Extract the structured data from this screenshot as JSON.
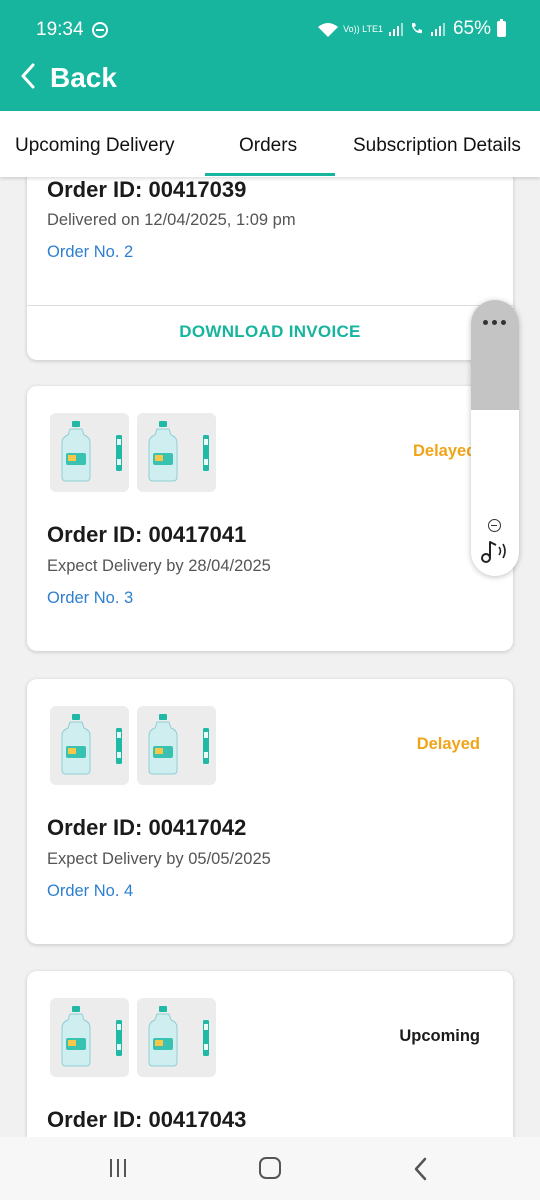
{
  "status_bar": {
    "time": "19:34",
    "lte_label": "Vo)) LTE1",
    "battery": "65%"
  },
  "header": {
    "back_label": "Back"
  },
  "tabs": [
    {
      "label": "Upcoming Delivery"
    },
    {
      "label": "Orders"
    },
    {
      "label": "Subscription Details"
    }
  ],
  "active_tab": "Orders",
  "orders": [
    {
      "order_id": "Order ID: 00417039",
      "date_text": "Delivered on 12/04/2025, 1:09 pm",
      "order_no": "Order No. 2",
      "action": "DOWNLOAD INVOICE"
    },
    {
      "order_id": "Order ID: 00417041",
      "date_text": "Expect Delivery by 28/04/2025",
      "order_no": "Order No. 3",
      "status": "Delayed",
      "product_icons": [
        "water-jar-icon",
        "water-jar-icon"
      ]
    },
    {
      "order_id": "Order ID: 00417042",
      "date_text": "Expect Delivery by 05/05/2025",
      "order_no": "Order No. 4",
      "status": "Delayed",
      "product_icons": [
        "water-jar-icon",
        "water-jar-icon"
      ]
    },
    {
      "order_id": "Order ID: 00417043",
      "status": "Upcoming",
      "product_icons": [
        "water-jar-icon",
        "water-jar-icon"
      ]
    }
  ],
  "colors": {
    "primary": "#17b49e",
    "delayed": "#f0a519",
    "link": "#2d7fd1"
  }
}
